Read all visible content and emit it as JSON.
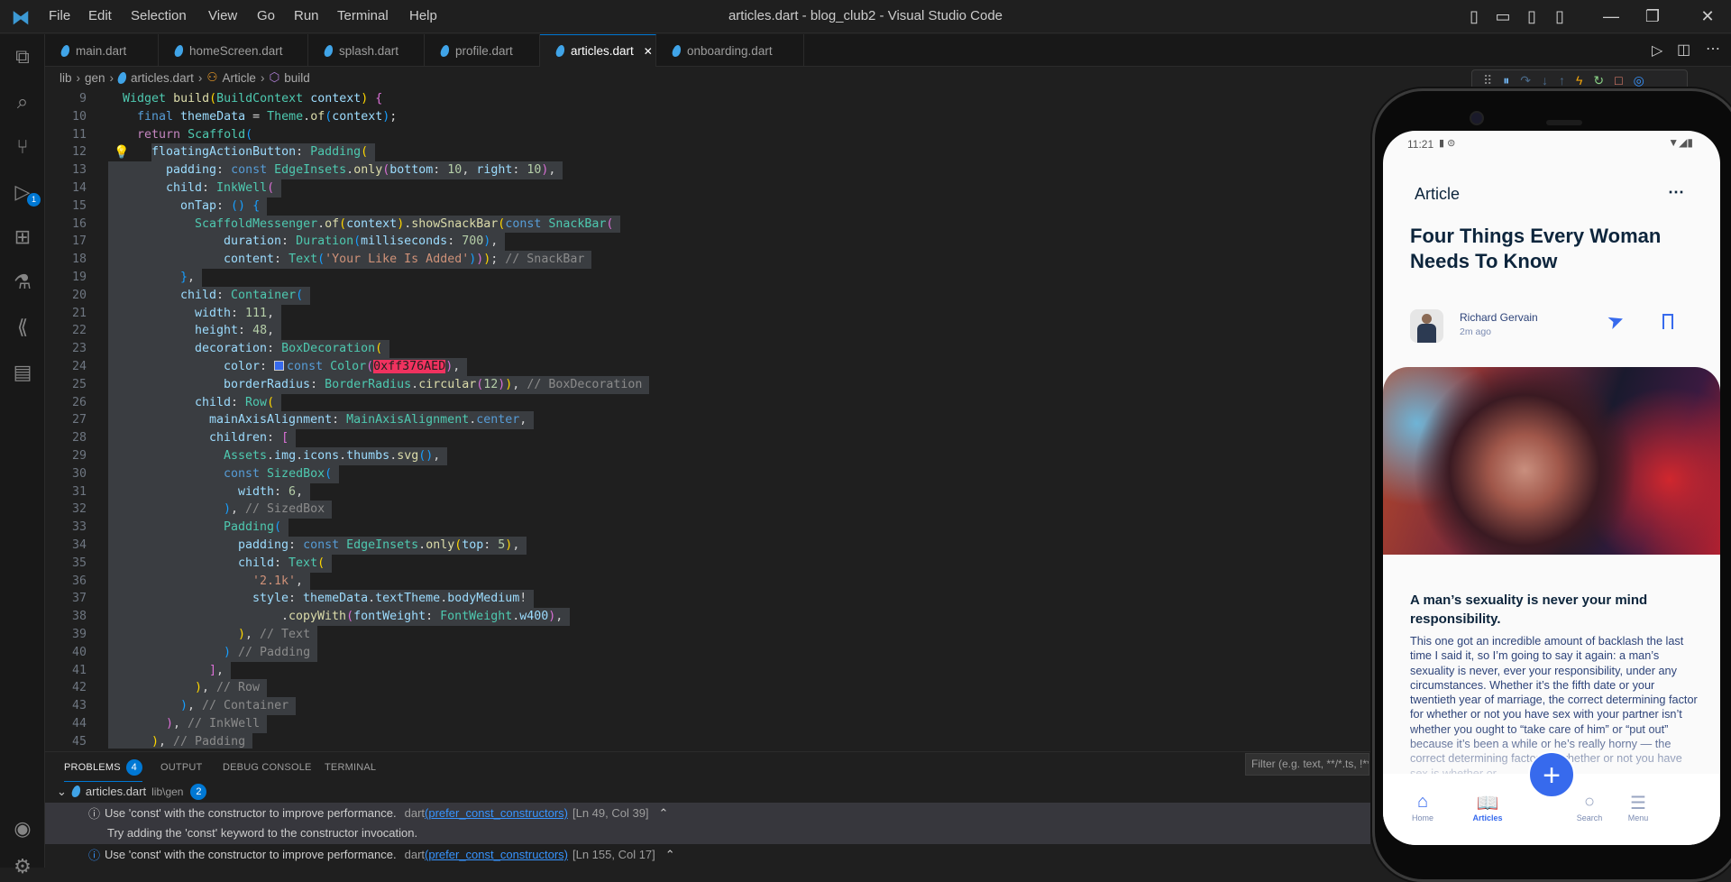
{
  "titlebar": {
    "menu": [
      "File",
      "Edit",
      "Selection",
      "View",
      "Go",
      "Run",
      "Terminal",
      "Help"
    ],
    "title": "articles.dart - blog_club2 - Visual Studio Code"
  },
  "tabs": [
    {
      "label": "main.dart"
    },
    {
      "label": "homeScreen.dart"
    },
    {
      "label": "splash.dart"
    },
    {
      "label": "profile.dart"
    },
    {
      "label": "articles.dart",
      "active": true
    },
    {
      "label": "onboarding.dart"
    }
  ],
  "close_glyph": "✕",
  "breadcrumb": [
    "lib",
    "gen",
    "articles.dart",
    "Article",
    "build"
  ],
  "activity_badge": "1",
  "code": [
    {
      "n": "9",
      "i": 2,
      "t": [
        [
          "Widget",
          "type"
        ],
        [
          " ",
          ""
        ],
        [
          "build",
          "func"
        ],
        [
          "(",
          "b1"
        ],
        [
          "BuildContext",
          "type"
        ],
        [
          " ",
          ""
        ],
        [
          "context",
          "prop"
        ],
        [
          ")",
          "b1"
        ],
        [
          " ",
          ""
        ],
        [
          "{",
          "b2"
        ]
      ]
    },
    {
      "n": "10",
      "i": 4,
      "t": [
        [
          "final",
          "storage"
        ],
        [
          " ",
          ""
        ],
        [
          "themeData",
          "prop"
        ],
        [
          " = ",
          "p"
        ],
        [
          "Theme",
          "type"
        ],
        [
          ".",
          "p"
        ],
        [
          "of",
          "func"
        ],
        [
          "(",
          "b3"
        ],
        [
          "context",
          "prop"
        ],
        [
          ")",
          "b3"
        ],
        [
          ";",
          "p"
        ]
      ]
    },
    {
      "n": "11",
      "i": 4,
      "t": [
        [
          "return",
          "kw"
        ],
        [
          " ",
          ""
        ],
        [
          "Scaffold",
          "type"
        ],
        [
          "(",
          "b3"
        ]
      ]
    },
    {
      "n": "12",
      "i": 6,
      "s": 1,
      "t": [
        [
          "floatingActionButton",
          "prop"
        ],
        [
          ": ",
          "p"
        ],
        [
          "Padding",
          "type"
        ],
        [
          "(",
          "b1"
        ]
      ]
    },
    {
      "n": "13",
      "i": 8,
      "s": 2,
      "t": [
        [
          "padding",
          "prop"
        ],
        [
          ": ",
          "p"
        ],
        [
          "const",
          "storage"
        ],
        [
          " ",
          ""
        ],
        [
          "EdgeInsets",
          "type"
        ],
        [
          ".",
          "p"
        ],
        [
          "only",
          "func"
        ],
        [
          "(",
          "b2"
        ],
        [
          "bottom",
          "prop"
        ],
        [
          ": ",
          "p"
        ],
        [
          "10",
          "num"
        ],
        [
          ", ",
          "p"
        ],
        [
          "right",
          "prop"
        ],
        [
          ": ",
          "p"
        ],
        [
          "10",
          "num"
        ],
        [
          ")",
          "b2"
        ],
        [
          ",",
          "p"
        ]
      ]
    },
    {
      "n": "14",
      "i": 8,
      "s": 2,
      "t": [
        [
          "child",
          "prop"
        ],
        [
          ": ",
          "p"
        ],
        [
          "InkWell",
          "type"
        ],
        [
          "(",
          "b2"
        ]
      ]
    },
    {
      "n": "15",
      "i": 10,
      "s": 2,
      "t": [
        [
          "onTap",
          "prop"
        ],
        [
          ": ",
          "p"
        ],
        [
          "() {",
          "b3"
        ]
      ]
    },
    {
      "n": "16",
      "i": 12,
      "s": 2,
      "t": [
        [
          "ScaffoldMessenger",
          "type"
        ],
        [
          ".",
          "p"
        ],
        [
          "of",
          "func"
        ],
        [
          "(",
          "b1"
        ],
        [
          "context",
          "prop"
        ],
        [
          ")",
          "b1"
        ],
        [
          ".",
          "p"
        ],
        [
          "showSnackBar",
          "func"
        ],
        [
          "(",
          "b1"
        ],
        [
          "const",
          "storage"
        ],
        [
          " ",
          ""
        ],
        [
          "SnackBar",
          "type"
        ],
        [
          "(",
          "b2"
        ]
      ]
    },
    {
      "n": "17",
      "i": 16,
      "s": 2,
      "t": [
        [
          "duration",
          "prop"
        ],
        [
          ": ",
          "p"
        ],
        [
          "Duration",
          "type"
        ],
        [
          "(",
          "b3"
        ],
        [
          "milliseconds",
          "prop"
        ],
        [
          ": ",
          "p"
        ],
        [
          "700",
          "num"
        ],
        [
          ")",
          "b3"
        ],
        [
          ",",
          "p"
        ]
      ]
    },
    {
      "n": "18",
      "i": 16,
      "s": 2,
      "t": [
        [
          "content",
          "prop"
        ],
        [
          ": ",
          "p"
        ],
        [
          "Text",
          "type"
        ],
        [
          "(",
          "b3"
        ],
        [
          "'Your Like Is Added'",
          "str"
        ],
        [
          ")",
          "b3"
        ],
        [
          ")",
          "b2"
        ],
        [
          ")",
          "b1"
        ],
        [
          ";",
          "p"
        ],
        [
          " // SnackBar",
          "cm"
        ]
      ]
    },
    {
      "n": "19",
      "i": 10,
      "s": 2,
      "t": [
        [
          "}",
          "b3"
        ],
        [
          ",",
          "p"
        ]
      ]
    },
    {
      "n": "20",
      "i": 10,
      "s": 2,
      "t": [
        [
          "child",
          "prop"
        ],
        [
          ": ",
          "p"
        ],
        [
          "Container",
          "type"
        ],
        [
          "(",
          "b3"
        ]
      ]
    },
    {
      "n": "21",
      "i": 12,
      "s": 2,
      "t": [
        [
          "width",
          "prop"
        ],
        [
          ": ",
          "p"
        ],
        [
          "111",
          "num"
        ],
        [
          ",",
          "p"
        ]
      ]
    },
    {
      "n": "22",
      "i": 12,
      "s": 2,
      "t": [
        [
          "height",
          "prop"
        ],
        [
          ": ",
          "p"
        ],
        [
          "48",
          "num"
        ],
        [
          ",",
          "p"
        ]
      ]
    },
    {
      "n": "23",
      "i": 12,
      "s": 2,
      "t": [
        [
          "decoration",
          "prop"
        ],
        [
          ": ",
          "p"
        ],
        [
          "BoxDecoration",
          "type"
        ],
        [
          "(",
          "b1"
        ]
      ]
    },
    {
      "n": "24",
      "i": 16,
      "s": 2,
      "sw": 1,
      "t": [
        [
          "color",
          "prop"
        ],
        [
          ": ",
          "p"
        ],
        [
          "",
          "swatch"
        ],
        [
          "const",
          "storage"
        ],
        [
          " ",
          ""
        ],
        [
          "Color",
          "type"
        ],
        [
          "(",
          "b2"
        ],
        [
          "0xff376AED",
          "hl"
        ],
        [
          ")",
          "b2"
        ],
        [
          ",",
          "p"
        ]
      ]
    },
    {
      "n": "25",
      "i": 16,
      "s": 2,
      "t": [
        [
          "borderRadius",
          "prop"
        ],
        [
          ": ",
          "p"
        ],
        [
          "BorderRadius",
          "type"
        ],
        [
          ".",
          "p"
        ],
        [
          "circular",
          "func"
        ],
        [
          "(",
          "b2"
        ],
        [
          "12",
          "num"
        ],
        [
          ")",
          "b2"
        ],
        [
          ")",
          "b1"
        ],
        [
          ",",
          "p"
        ],
        [
          " // BoxDecoration",
          "cm"
        ]
      ]
    },
    {
      "n": "26",
      "i": 12,
      "s": 2,
      "t": [
        [
          "child",
          "prop"
        ],
        [
          ": ",
          "p"
        ],
        [
          "Row",
          "type"
        ],
        [
          "(",
          "b1"
        ]
      ]
    },
    {
      "n": "27",
      "i": 14,
      "s": 2,
      "t": [
        [
          "mainAxisAlignment",
          "prop"
        ],
        [
          ": ",
          "p"
        ],
        [
          "MainAxisAlignment",
          "type"
        ],
        [
          ".",
          "p"
        ],
        [
          "center",
          "storage"
        ],
        [
          ",",
          "p"
        ]
      ]
    },
    {
      "n": "28",
      "i": 14,
      "s": 2,
      "t": [
        [
          "children",
          "prop"
        ],
        [
          ": ",
          "p"
        ],
        [
          "[",
          "b2"
        ]
      ]
    },
    {
      "n": "29",
      "i": 16,
      "s": 2,
      "t": [
        [
          "Assets",
          "type"
        ],
        [
          ".",
          "p"
        ],
        [
          "img",
          "prop"
        ],
        [
          ".",
          "p"
        ],
        [
          "icons",
          "prop"
        ],
        [
          ".",
          "p"
        ],
        [
          "thumbs",
          "prop"
        ],
        [
          ".",
          "p"
        ],
        [
          "svg",
          "func"
        ],
        [
          "()",
          "b3"
        ],
        [
          ",",
          "p"
        ]
      ]
    },
    {
      "n": "30",
      "i": 16,
      "s": 2,
      "t": [
        [
          "const",
          "storage"
        ],
        [
          " ",
          ""
        ],
        [
          "SizedBox",
          "type"
        ],
        [
          "(",
          "b3"
        ]
      ]
    },
    {
      "n": "31",
      "i": 18,
      "s": 2,
      "t": [
        [
          "width",
          "prop"
        ],
        [
          ": ",
          "p"
        ],
        [
          "6",
          "num"
        ],
        [
          ",",
          "p"
        ]
      ]
    },
    {
      "n": "32",
      "i": 16,
      "s": 2,
      "t": [
        [
          ")",
          "b3"
        ],
        [
          ", ",
          "p"
        ],
        [
          "// SizedBox",
          "cm"
        ]
      ]
    },
    {
      "n": "33",
      "i": 16,
      "s": 2,
      "t": [
        [
          "Padding",
          "type"
        ],
        [
          "(",
          "b3"
        ]
      ]
    },
    {
      "n": "34",
      "i": 18,
      "s": 2,
      "t": [
        [
          "padding",
          "prop"
        ],
        [
          ": ",
          "p"
        ],
        [
          "const",
          "storage"
        ],
        [
          " ",
          ""
        ],
        [
          "EdgeInsets",
          "type"
        ],
        [
          ".",
          "p"
        ],
        [
          "only",
          "func"
        ],
        [
          "(",
          "b1"
        ],
        [
          "top",
          "prop"
        ],
        [
          ": ",
          "p"
        ],
        [
          "5",
          "num"
        ],
        [
          ")",
          "b1"
        ],
        [
          ",",
          "p"
        ]
      ]
    },
    {
      "n": "35",
      "i": 18,
      "s": 2,
      "t": [
        [
          "child",
          "prop"
        ],
        [
          ": ",
          "p"
        ],
        [
          "Text",
          "type"
        ],
        [
          "(",
          "b1"
        ]
      ]
    },
    {
      "n": "36",
      "i": 20,
      "s": 2,
      "t": [
        [
          "'2.1k'",
          "str"
        ],
        [
          ",",
          "p"
        ]
      ]
    },
    {
      "n": "37",
      "i": 20,
      "s": 2,
      "t": [
        [
          "style",
          "prop"
        ],
        [
          ": ",
          "p"
        ],
        [
          "themeData",
          "prop"
        ],
        [
          ".",
          "p"
        ],
        [
          "textTheme",
          "prop"
        ],
        [
          ".",
          "p"
        ],
        [
          "bodyMedium",
          "prop"
        ],
        [
          "!",
          "p"
        ]
      ]
    },
    {
      "n": "38",
      "i": 24,
      "s": 2,
      "t": [
        [
          ".",
          "p"
        ],
        [
          "copyWith",
          "func"
        ],
        [
          "(",
          "b2"
        ],
        [
          "fontWeight",
          "prop"
        ],
        [
          ": ",
          "p"
        ],
        [
          "FontWeight",
          "type"
        ],
        [
          ".",
          "p"
        ],
        [
          "w400",
          "prop"
        ],
        [
          ")",
          "b2"
        ],
        [
          ",",
          "p"
        ]
      ]
    },
    {
      "n": "39",
      "i": 18,
      "s": 2,
      "t": [
        [
          ")",
          "b1"
        ],
        [
          ", ",
          "p"
        ],
        [
          "// Text",
          "cm"
        ]
      ]
    },
    {
      "n": "40",
      "i": 16,
      "s": 2,
      "t": [
        [
          ")",
          "b3"
        ],
        [
          " ",
          "p"
        ],
        [
          "// Padding",
          "cm"
        ]
      ]
    },
    {
      "n": "41",
      "i": 14,
      "s": 2,
      "t": [
        [
          "]",
          "b2"
        ],
        [
          ",",
          "p"
        ]
      ]
    },
    {
      "n": "42",
      "i": 12,
      "s": 2,
      "t": [
        [
          ")",
          "b1"
        ],
        [
          ", ",
          "p"
        ],
        [
          "// Row",
          "cm"
        ]
      ]
    },
    {
      "n": "43",
      "i": 10,
      "s": 2,
      "t": [
        [
          ")",
          "b3"
        ],
        [
          ", ",
          "p"
        ],
        [
          "// Container",
          "cm"
        ]
      ]
    },
    {
      "n": "44",
      "i": 8,
      "s": 2,
      "t": [
        [
          ")",
          "b2"
        ],
        [
          ", ",
          "p"
        ],
        [
          "// InkWell",
          "cm"
        ]
      ]
    },
    {
      "n": "45",
      "i": 6,
      "s": 2,
      "t": [
        [
          ")",
          "b1"
        ],
        [
          ", ",
          "p"
        ],
        [
          "// Padding",
          "cm"
        ]
      ]
    }
  ],
  "panel": {
    "tabs": [
      "PROBLEMS",
      "OUTPUT",
      "DEBUG CONSOLE",
      "TERMINAL"
    ],
    "problem_count": "4",
    "filter_placeholder": "Filter (e.g. text, **/*.ts, !**/node_modules/**)",
    "file": {
      "name": "articles.dart",
      "path": "lib\\gen",
      "count": "2"
    },
    "problems": [
      {
        "message": "Use 'const' with the constructor to improve performance.",
        "source": "dart",
        "code": "(prefer_const_constructors)",
        "location": "[Ln 49, Col 39]",
        "hint": "Try adding the 'const' keyword to the constructor invocation."
      },
      {
        "message": "Use 'const' with the constructor to improve performance.",
        "source": "dart",
        "code": "(prefer_const_constructors)",
        "location": "[Ln 155, Col 17]"
      }
    ]
  },
  "phone": {
    "time": "11:21",
    "appbar_title": "Article",
    "title": "Four Things Every Woman Needs To Know",
    "author": "Richard Gervain",
    "posted": "2m ago",
    "heading": "A man’s sexuality is never your mind responsibility.",
    "body": "This one got an incredible amount of backlash the last time I said it, so I’m going to say it again: a man’s sexuality is never, ever your responsibility, under any circumstances. Whether it’s the fifth date or your twentieth year of marriage, the correct determining factor for whether or not you have sex with your partner isn’t whether you ought to “take care of him” or “put out” because it’s been a while or he’s really horny — the correct determining factor for whether or not you have sex is whether or",
    "nav": [
      "Home",
      "Articles",
      "Search",
      "Menu"
    ],
    "nav_active": "Articles",
    "accent": "#376AED"
  }
}
